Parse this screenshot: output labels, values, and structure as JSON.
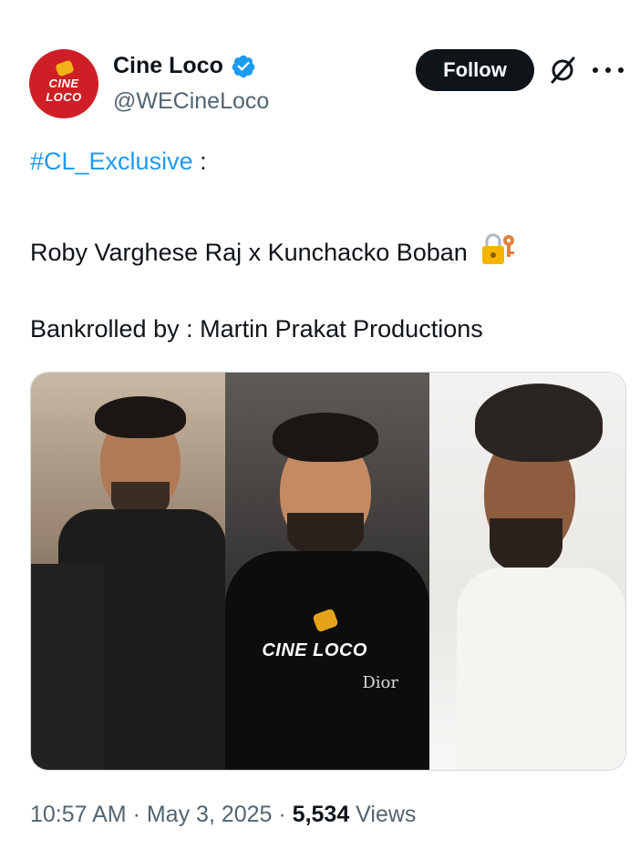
{
  "author": {
    "display_name": "Cine Loco",
    "handle": "@WECineLoco",
    "avatar_text": "CINE LOCO",
    "verified": true
  },
  "actions": {
    "follow_label": "Follow"
  },
  "tweet": {
    "hashtag": "#CL_Exclusive",
    "hashtag_suffix": " :",
    "line_2": "Roby Varghese Raj x Kunchacko Boban",
    "line_2_emoji": "lock-with-key",
    "line_3": "Bankrolled by : Martin Prakat Productions"
  },
  "media": {
    "watermark": "CINE LOCO",
    "shirt_text": "Dior"
  },
  "meta": {
    "time": "10:57 AM",
    "sep1": " · ",
    "date": "May 3, 2025",
    "sep2": " · ",
    "views_count": "5,534",
    "views_label": " Views"
  },
  "colors": {
    "accent": "#1d9bf0",
    "text": "#0f1419",
    "muted": "#536471",
    "brand_red": "#cf1e25"
  }
}
